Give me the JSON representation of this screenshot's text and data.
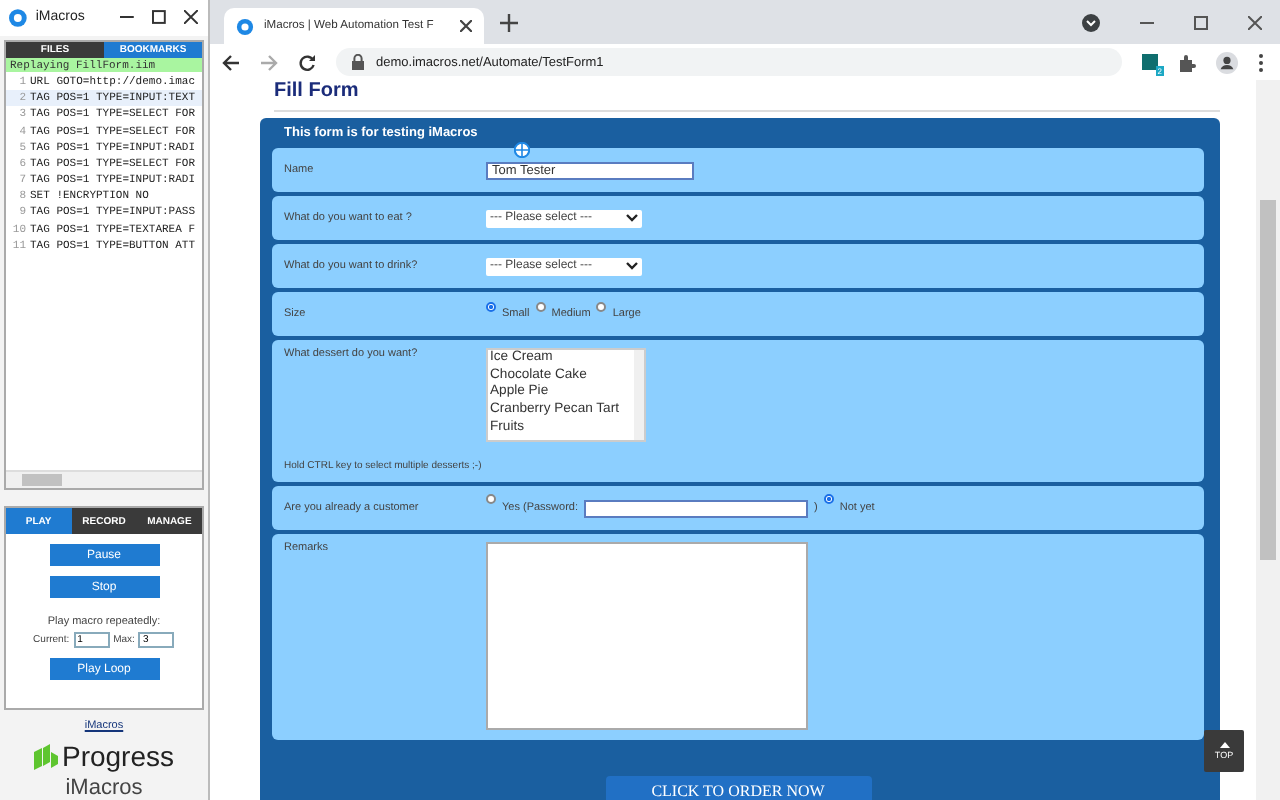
{
  "imacros_panel": {
    "title": "iMacros",
    "top_tabs": [
      {
        "label": "FILES",
        "selected": false
      },
      {
        "label": "BOOKMARKS",
        "selected": true
      }
    ],
    "status": "Replaying FillForm.iim",
    "code_lines": [
      {
        "number": "1",
        "text": "URL GOTO=http://demo.imac",
        "selected": false
      },
      {
        "number": "2",
        "text": "TAG POS=1 TYPE=INPUT:TEXT",
        "selected": true
      },
      {
        "number": "3",
        "text": "TAG POS=1 TYPE=SELECT FOR",
        "selected": false
      },
      {
        "number": "4",
        "text": "TAG POS=1 TYPE=SELECT FOR",
        "selected": false
      },
      {
        "number": "5",
        "text": "TAG POS=1 TYPE=INPUT:RADI",
        "selected": false
      },
      {
        "number": "6",
        "text": "TAG POS=1 TYPE=SELECT FOR",
        "selected": false
      },
      {
        "number": "7",
        "text": "TAG POS=1 TYPE=INPUT:RADI",
        "selected": false
      },
      {
        "number": "8",
        "text": "SET !ENCRYPTION NO",
        "selected": false
      },
      {
        "number": "9",
        "text": "TAG POS=1 TYPE=INPUT:PASS",
        "selected": false
      },
      {
        "number": "10",
        "text": "TAG POS=1 TYPE=TEXTAREA F",
        "selected": false
      },
      {
        "number": "11",
        "text": "TAG POS=1 TYPE=BUTTON ATT",
        "selected": false
      }
    ],
    "bottom_tabs": [
      {
        "label": "PLAY",
        "selected": true
      },
      {
        "label": "RECORD",
        "selected": false
      },
      {
        "label": "MANAGE",
        "selected": false
      }
    ],
    "buttons": [
      "Pause",
      "Stop"
    ],
    "repeat_label": "Play macro repeatedly:",
    "current": {
      "label": "Current:",
      "value": "1"
    },
    "max": {
      "label": "Max:",
      "value": "3"
    },
    "loop_button": "Play Loop",
    "link": "iMacros",
    "logo": {
      "brand": "Progress",
      "product": "iMacros"
    }
  },
  "browser": {
    "tab": {
      "title": "iMacros | Web Automation Test F"
    },
    "url": "demo.imacros.net/Automate/TestForm1",
    "extension_badge": "2",
    "page": {
      "heading": "Fill Form",
      "form_title": "This form is for testing iMacros",
      "name": {
        "label": "Name",
        "value": "Tom Tester"
      },
      "eat": {
        "label": "What do you want to eat ?",
        "value": "--- Please select ---"
      },
      "drink": {
        "label": "What do you want to drink?",
        "value": "--- Please select ---"
      },
      "size": {
        "label": "Size",
        "options": [
          {
            "label": "Small",
            "selected": true
          },
          {
            "label": "Medium",
            "selected": false
          },
          {
            "label": "Large",
            "selected": false
          }
        ]
      },
      "dessert": {
        "label": "What dessert do you want?",
        "options": [
          "Ice Cream",
          "Chocolate Cake",
          "Apple Pie",
          "Cranberry Pecan Tart",
          "Fruits"
        ],
        "hint": "Hold CTRL key to select multiple desserts ;-)"
      },
      "customer": {
        "label": "Are you already a customer",
        "yes": {
          "label": "Yes (Password:",
          "selected": false
        },
        "closing": ")",
        "no": {
          "label": "Not yet",
          "selected": true
        }
      },
      "remarks": {
        "label": "Remarks"
      },
      "submit": "CLICK TO ORDER NOW",
      "top_button": "TOP"
    }
  }
}
